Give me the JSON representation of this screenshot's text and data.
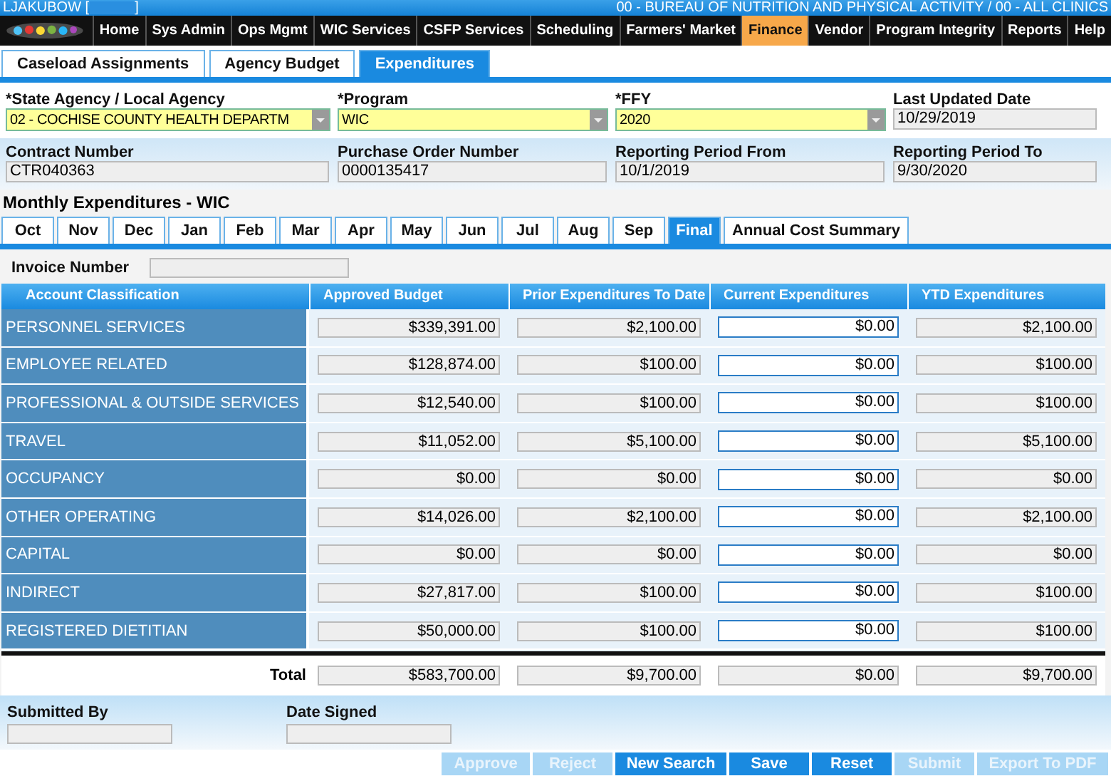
{
  "header": {
    "user": "LJAKUBOW [",
    "user_end": "]",
    "agency": "00 - BUREAU OF NUTRITION AND PHYSICAL ACTIVITY / 00 - ALL CLINICS"
  },
  "nav": [
    {
      "label": "Home",
      "selected": false
    },
    {
      "label": "Sys Admin",
      "selected": false
    },
    {
      "label": "Ops Mgmt",
      "selected": false
    },
    {
      "label": "WIC Services",
      "selected": false
    },
    {
      "label": "CSFP Services",
      "selected": false
    },
    {
      "label": "Scheduling",
      "selected": false
    },
    {
      "label": "Farmers' Market",
      "selected": false
    },
    {
      "label": "Finance",
      "selected": true
    },
    {
      "label": "Vendor",
      "selected": false
    },
    {
      "label": "Program Integrity",
      "selected": false
    },
    {
      "label": "Reports",
      "selected": false
    },
    {
      "label": "Help",
      "selected": false
    }
  ],
  "tabs": [
    {
      "label": "Caseload Assignments",
      "selected": false
    },
    {
      "label": "Agency Budget",
      "selected": false
    },
    {
      "label": "Expenditures",
      "selected": true
    }
  ],
  "filters": [
    {
      "label": "*State Agency / Local Agency",
      "value": "02 - COCHISE COUNTY HEALTH DEPARTM",
      "kind": "dropdown"
    },
    {
      "label": "*Program",
      "value": "WIC",
      "kind": "dropdown"
    },
    {
      "label": "*FFY",
      "value": "2020",
      "kind": "dropdown"
    },
    {
      "label": "Last Updated Date",
      "value": "10/29/2019",
      "kind": "readonly"
    }
  ],
  "details": [
    {
      "label": "Contract Number",
      "value": "CTR040363"
    },
    {
      "label": "Purchase Order Number",
      "value": "0000135417"
    },
    {
      "label": "Reporting Period From",
      "value": "10/1/2019"
    },
    {
      "label": "Reporting Period To",
      "value": "9/30/2020"
    }
  ],
  "section_title": "Monthly Expenditures - WIC",
  "month_tabs": [
    {
      "label": "Oct",
      "selected": false
    },
    {
      "label": "Nov",
      "selected": false
    },
    {
      "label": "Dec",
      "selected": false
    },
    {
      "label": "Jan",
      "selected": false
    },
    {
      "label": "Feb",
      "selected": false
    },
    {
      "label": "Mar",
      "selected": false
    },
    {
      "label": "Apr",
      "selected": false
    },
    {
      "label": "May",
      "selected": false
    },
    {
      "label": "Jun",
      "selected": false
    },
    {
      "label": "Jul",
      "selected": false
    },
    {
      "label": "Aug",
      "selected": false
    },
    {
      "label": "Sep",
      "selected": false
    },
    {
      "label": "Final",
      "selected": true
    },
    {
      "label": "Annual Cost Summary",
      "selected": false
    }
  ],
  "invoice": {
    "label": "Invoice Number"
  },
  "table": {
    "columns": [
      {
        "label": "Account Classification",
        "editable": false
      },
      {
        "label": "Approved Budget",
        "editable": false
      },
      {
        "label": "Prior Expenditures To Date",
        "editable": false
      },
      {
        "label": "Current Expenditures",
        "editable": true
      },
      {
        "label": "YTD Expenditures",
        "editable": false
      }
    ],
    "rows": [
      {
        "name": "PERSONNEL SERVICES",
        "values": [
          "$339,391.00",
          "$2,100.00",
          "$0.00",
          "$2,100.00"
        ]
      },
      {
        "name": "EMPLOYEE RELATED",
        "values": [
          "$128,874.00",
          "$100.00",
          "$0.00",
          "$100.00"
        ]
      },
      {
        "name": "PROFESSIONAL & OUTSIDE SERVICES",
        "values": [
          "$12,540.00",
          "$100.00",
          "$0.00",
          "$100.00"
        ]
      },
      {
        "name": "TRAVEL",
        "values": [
          "$11,052.00",
          "$5,100.00",
          "$0.00",
          "$5,100.00"
        ]
      },
      {
        "name": "OCCUPANCY",
        "values": [
          "$0.00",
          "$0.00",
          "$0.00",
          "$0.00"
        ]
      },
      {
        "name": "OTHER OPERATING",
        "values": [
          "$14,026.00",
          "$2,100.00",
          "$0.00",
          "$2,100.00"
        ]
      },
      {
        "name": "CAPITAL",
        "values": [
          "$0.00",
          "$0.00",
          "$0.00",
          "$0.00"
        ]
      },
      {
        "name": "INDIRECT",
        "values": [
          "$27,817.00",
          "$100.00",
          "$0.00",
          "$100.00"
        ]
      },
      {
        "name": "REGISTERED DIETITIAN",
        "values": [
          "$50,000.00",
          "$100.00",
          "$0.00",
          "$100.00"
        ]
      }
    ],
    "total": {
      "label": "Total",
      "values": [
        "$583,700.00",
        "$9,700.00",
        "$0.00",
        "$9,700.00"
      ]
    }
  },
  "signature": [
    {
      "label": "Submitted By"
    },
    {
      "label": "Date Signed"
    }
  ],
  "buttons": [
    {
      "label": "Approve",
      "disabled": true
    },
    {
      "label": "Reject",
      "disabled": true
    },
    {
      "label": "New Search",
      "disabled": false
    },
    {
      "label": "Save",
      "disabled": false
    },
    {
      "label": "Reset",
      "disabled": false
    },
    {
      "label": "Submit",
      "disabled": true
    },
    {
      "label": "Export To PDF",
      "disabled": true
    }
  ]
}
